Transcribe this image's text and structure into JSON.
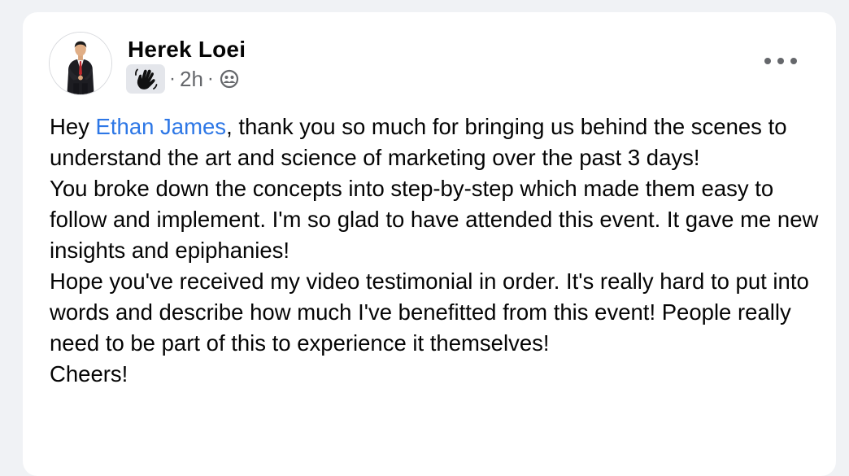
{
  "post": {
    "author": "Herek Loei",
    "time": "2h",
    "separator": "·",
    "badge_icon": "waving-hand-icon",
    "audience_icon": "friends-globe-icon",
    "more_icon": "more-options-icon",
    "mention": "Ethan James",
    "line1_before": "Hey ",
    "line1_after": ", thank you so much for bringing us behind the scenes to understand the art and science of marketing over the past 3 days!",
    "paragraph2": "You broke down the concepts into step-by-step which made them easy to follow and implement. I'm so glad to have attended this event. It gave me new insights and epiphanies!",
    "paragraph3": "Hope you've received my video testimonial in order. It's really hard to put into words and describe how much I've benefitted from this event! People really need to be part of this to experience it themselves!",
    "paragraph4": "Cheers!"
  },
  "colors": {
    "background": "#f0f2f5",
    "card": "#ffffff",
    "mention": "#2d77e6",
    "secondary_text": "#65676b"
  }
}
